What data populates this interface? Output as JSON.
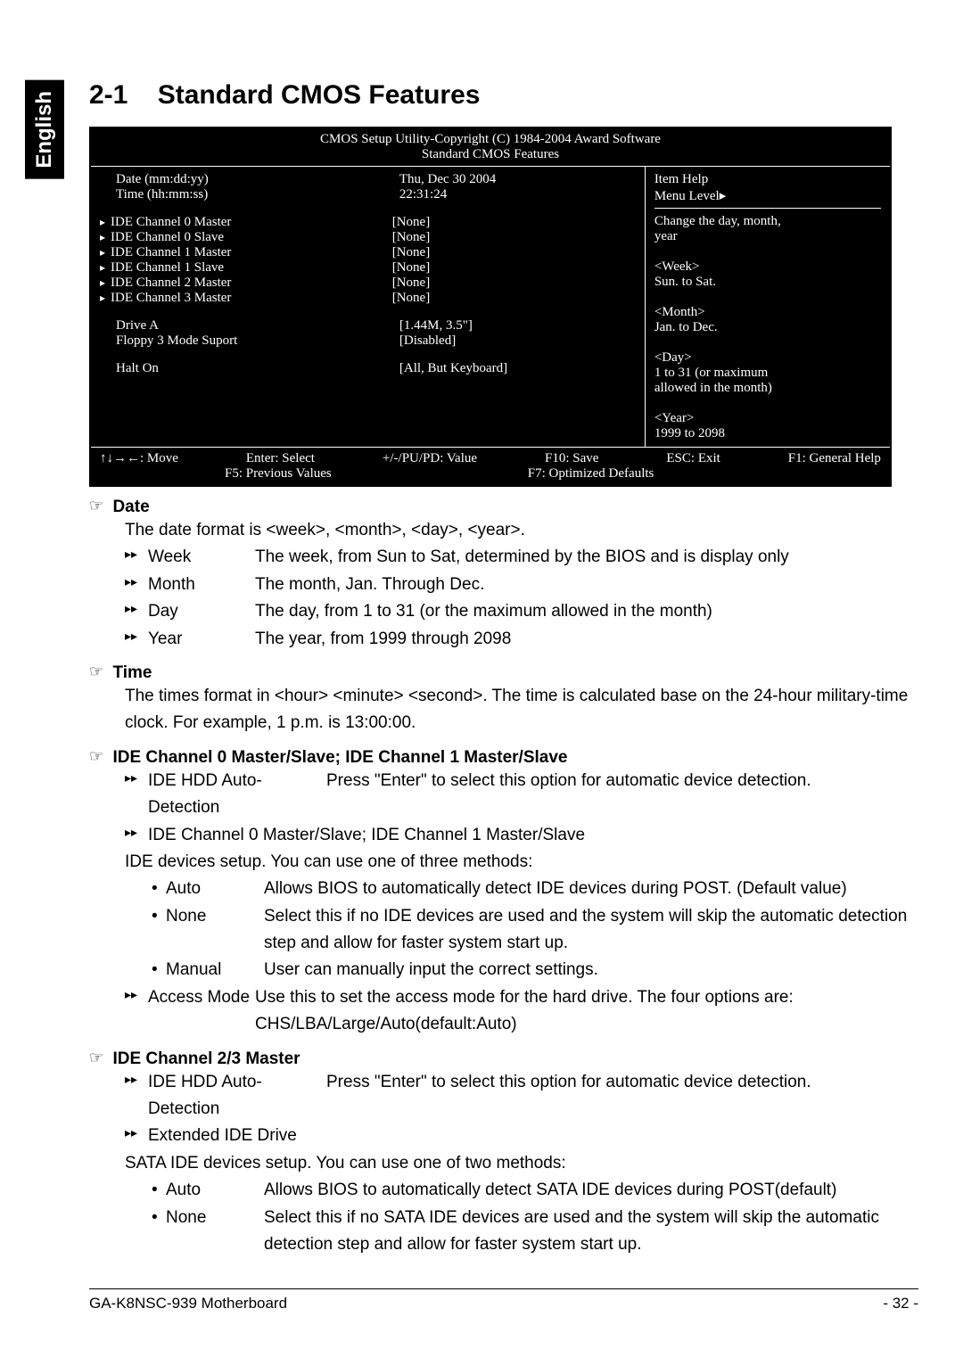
{
  "side_tab": "English",
  "section_number": "2-1",
  "section_title": "Standard CMOS Features",
  "bios": {
    "header_line1": "CMOS Setup Utility-Copyright (C) 1984-2004 Award Software",
    "header_line2": "Standard CMOS Features",
    "rows": [
      {
        "arrow": false,
        "label": "Date (mm:dd:yy)",
        "value": "Thu, Dec  30  2004"
      },
      {
        "arrow": false,
        "label": "Time (hh:mm:ss)",
        "value": "22:31:24"
      }
    ],
    "ide_rows": [
      {
        "arrow": true,
        "label": "IDE Channel 0 Master",
        "value": "[None]"
      },
      {
        "arrow": true,
        "label": "IDE Channel 0 Slave",
        "value": "[None]"
      },
      {
        "arrow": true,
        "label": "IDE Channel 1 Master",
        "value": "[None]"
      },
      {
        "arrow": true,
        "label": "IDE Channel 1 Slave",
        "value": "[None]"
      },
      {
        "arrow": true,
        "label": "IDE Channel 2 Master",
        "value": "[None]"
      },
      {
        "arrow": true,
        "label": "IDE Channel 3 Master",
        "value": "[None]"
      }
    ],
    "drive_rows": [
      {
        "arrow": false,
        "label": "Drive A",
        "value": "[1.44M, 3.5\"]"
      },
      {
        "arrow": false,
        "label": "Floppy 3 Mode Suport",
        "value": "[Disabled]"
      }
    ],
    "halt_row": {
      "arrow": false,
      "label": "Halt On",
      "value": "[All, But Keyboard]"
    },
    "help": {
      "title": "Item Help",
      "menu_level": "Menu Level▸",
      "lines": [
        "Change the day, month,",
        "year",
        "",
        "<Week>",
        "Sun. to Sat.",
        "",
        "<Month>",
        "Jan. to Dec.",
        "",
        "<Day>",
        "1 to 31 (or maximum",
        "allowed in the month)",
        "",
        "<Year>",
        "1999 to 2098"
      ]
    },
    "footer": {
      "row1": [
        "↑↓→←: Move",
        "Enter: Select",
        "+/-/PU/PD: Value",
        "F10: Save",
        "ESC: Exit",
        "F1: General Help"
      ],
      "row2": [
        "F5: Previous Values",
        "F7: Optimized Defaults"
      ]
    }
  },
  "date_section": {
    "heading": "Date",
    "intro": "The date format is <week>, <month>, <day>, <year>.",
    "items": [
      {
        "label": "Week",
        "desc": "The week, from Sun to Sat, determined by the BIOS and is display only"
      },
      {
        "label": "Month",
        "desc": "The month, Jan. Through Dec."
      },
      {
        "label": "Day",
        "desc": "The day, from 1 to 31 (or the maximum allowed in the month)"
      },
      {
        "label": "Year",
        "desc": "The year, from 1999 through 2098"
      }
    ]
  },
  "time_section": {
    "heading": "Time",
    "text": "The times format in <hour> <minute> <second>. The time is calculated base on the 24-hour military-time clock. For example, 1 p.m. is 13:00:00."
  },
  "ide01_section": {
    "heading": "IDE Channel 0 Master/Slave; IDE Channel 1 Master/Slave",
    "line1_label": "IDE HDD Auto-Detection",
    "line1_desc": "Press \"Enter\" to select this option for automatic device detection.",
    "line2": "IDE Channel 0 Master/Slave; IDE Channel 1 Master/Slave",
    "intro": "IDE devices setup.  You can use one of three methods:",
    "bullets": [
      {
        "label": "Auto",
        "desc": "Allows BIOS to automatically detect IDE devices during POST. (Default value)"
      },
      {
        "label": "None",
        "desc": "Select this if no IDE devices are used and the system will skip the automatic detection step and allow for faster system start up."
      },
      {
        "label": "Manual",
        "desc": "User can manually input the correct settings."
      }
    ],
    "access_label": "Access Mode",
    "access_desc": "Use this to set the access mode for the hard drive. The four options are: CHS/LBA/Large/Auto(default:Auto)"
  },
  "ide23_section": {
    "heading": "IDE Channel 2/3 Master",
    "line1_label": "IDE HDD Auto-Detection",
    "line1_desc": "Press \"Enter\" to select this option for automatic device detection.",
    "line2": "Extended IDE Drive",
    "intro": "SATA IDE devices setup. You can use one of two methods:",
    "bullets": [
      {
        "label": "Auto",
        "desc": "Allows BIOS to automatically detect SATA IDE devices during POST(default)"
      },
      {
        "label": "None",
        "desc": "Select this if no SATA IDE devices are used and the system will skip the automatic detection step and allow for faster system start up."
      }
    ]
  },
  "footer": {
    "left": "GA-K8NSC-939 Motherboard",
    "mid": "- 32 -"
  },
  "glyphs": {
    "hand": "☞",
    "dblarrow": "▸▸",
    "bullet": "•"
  }
}
